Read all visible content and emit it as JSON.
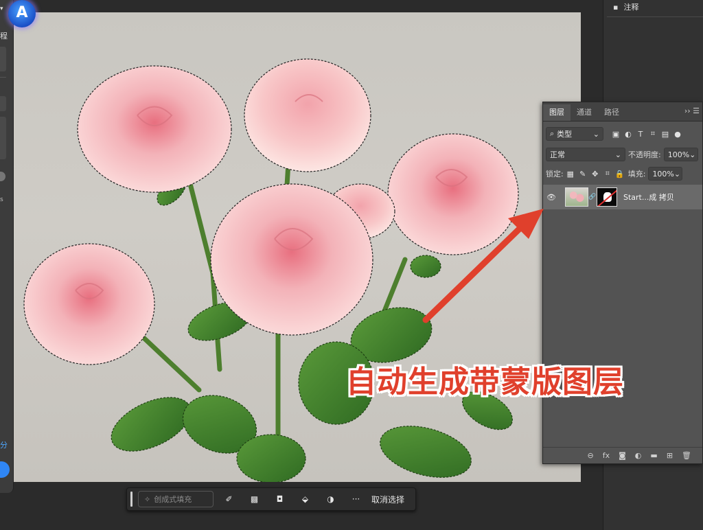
{
  "left_panel": {
    "partial_text_top": "程",
    "partial_text_bottom": "分",
    "partial_text_mid": "s"
  },
  "right_dock": {
    "notes_label": "注释"
  },
  "layers_panel": {
    "tabs": [
      "图层",
      "通道",
      "路径"
    ],
    "active_tab": "图层",
    "menu_icon": ">>",
    "filter_kind": "类型",
    "blend_mode": "正常",
    "opacity_label": "不透明度:",
    "opacity_value": "100%",
    "lock_label": "锁定:",
    "fill_label": "填充:",
    "fill_value": "100%",
    "layer": {
      "name": "Start...成 拷贝",
      "visible": true
    },
    "filter_icons": [
      "image-filter-icon",
      "adjustment-filter-icon",
      "type-filter-icon",
      "shape-filter-icon",
      "smart-object-filter-icon"
    ],
    "lock_icons": [
      "lock-transparent-icon",
      "lock-image-icon",
      "lock-position-icon",
      "lock-artboard-icon",
      "lock-all-icon"
    ],
    "footer_icons": [
      "link-layers-icon",
      "fx-icon",
      "add-mask-icon",
      "adjustment-layer-icon",
      "new-group-icon",
      "new-layer-icon",
      "delete-layer-icon"
    ]
  },
  "taskbar": {
    "generative_fill_label": "创成式填充",
    "deselect_label": "取消选择",
    "icons": [
      "select-subject-icon",
      "modify-selection-icon",
      "mask-icon",
      "fill-icon",
      "adjustment-icon",
      "more-icon"
    ]
  },
  "annotation": {
    "text": "自动生成带蒙版图层",
    "color": "#e0402c"
  },
  "app_icon_letter": "A"
}
